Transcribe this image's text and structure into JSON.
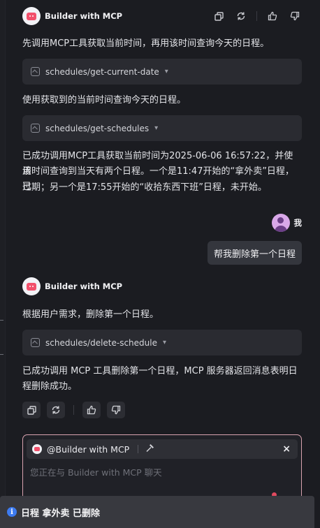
{
  "bot": {
    "name": "Builder with MCP"
  },
  "user": {
    "name": "我"
  },
  "messages": {
    "m1_text": "先调用MCP工具获取当前时间，再用该时间查询今天的日程。",
    "tool1": "schedules/get-current-date",
    "m2_text": "使用获取到的当前时间查询今天的日程。",
    "tool2": "schedules/get-schedules",
    "m3_line1": "已成功调用MCP工具获取当前时间为2025-06-06 16:57:22，并使用",
    "m3_line2": "该时间查询到当天有两个日程。一个是11:47开始的“拿外卖”日程，已",
    "m3_line3": "过期；另一个是17:55开始的“收拾东西下班”日程，未开始。",
    "user_msg": "帮我删除第一个日程",
    "m4_text": "根据用户需求，删除第一个日程。",
    "tool3": "schedules/delete-schedule",
    "m5_line1": "已成功调用 MCP 工具删除第一个日程，MCP 服务器返回消息表明日",
    "m5_line2": "程删除成功。"
  },
  "input": {
    "mention": "@Builder with MCP",
    "close": "×",
    "placeholder": "您正在与 Builder with MCP 聊天"
  },
  "toast": {
    "icon": "i",
    "text": "日程 拿外卖 已删除"
  },
  "icons": {
    "copy": "copy-icon",
    "regenerate": "refresh-icon",
    "like": "thumbs-up-icon",
    "dislike": "thumbs-down-icon",
    "tool": "tool-icon",
    "chevron": "chevron-down-icon",
    "hammer": "hammer-icon",
    "info": "info-icon"
  },
  "colors": {
    "accent_border": "#d9a3b0",
    "info": "#3d7bf0",
    "bot_face": "#f24f6b",
    "user_avatar": "#d9a8e8"
  }
}
